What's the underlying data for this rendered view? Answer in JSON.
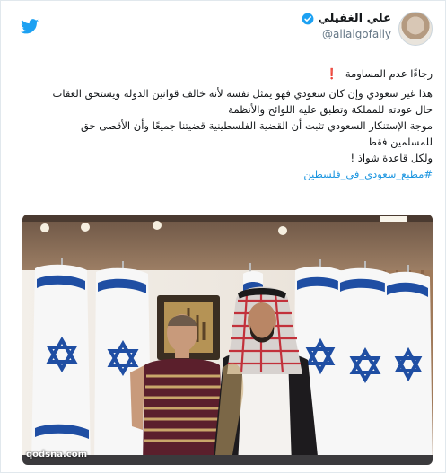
{
  "tweet": {
    "display_name": "علي الغفيلي",
    "handle": "@alialgofaily",
    "lines": [
      "رجاءًا عدم المساومة",
      "هذا غير سعودي وإن كان سعودي فهو يمثل نفسه لأنه خالف قوانين الدولة ويستحق العقاب",
      "حال عودته للمملكة وتطبق عليه اللوائح والأنظمة",
      "موجة الإستنكار السعودي تثبت أن القضية الفلسطينية قضيتنا جميعًا وأن الأقصى حق",
      "للمسلمين فقط",
      "ولكل قاعدة شواذ !"
    ],
    "red_mark": "❗",
    "hashtag": "#مطبع_سعودي_في_فلسطين"
  },
  "photo": {
    "watermark": "qodsna.com"
  },
  "icons": {
    "brand": "twitter-bird-icon",
    "verified": "verified-badge-icon"
  },
  "colors": {
    "twitter_blue": "#1da1f2",
    "hashtag_blue": "#1b95e0",
    "text": "#14171a",
    "muted": "#657786",
    "exclamation_red": "#e0245e",
    "flag_blue": "#1f4ea3"
  }
}
